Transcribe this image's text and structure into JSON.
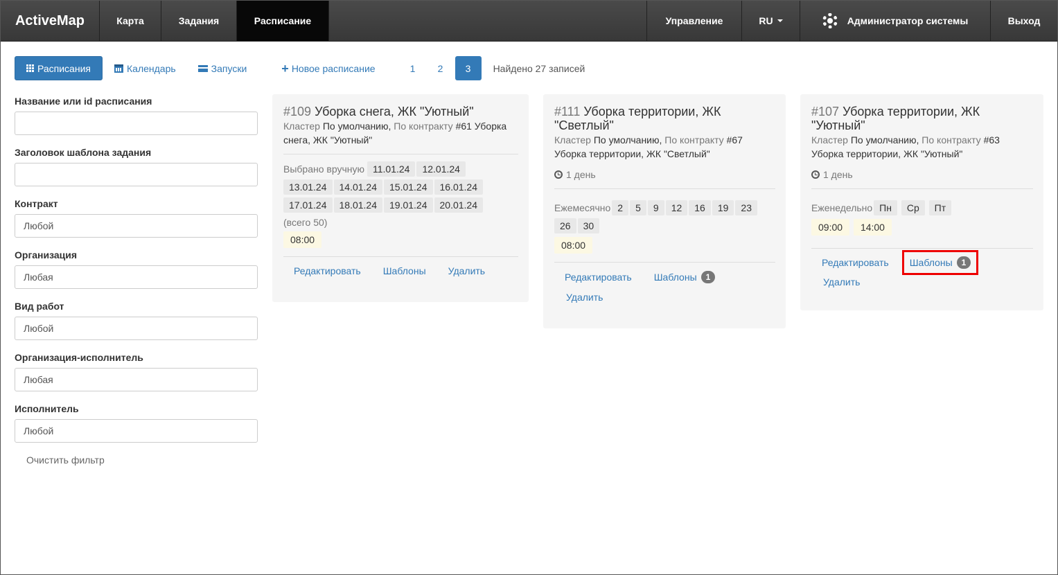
{
  "navbar": {
    "brand": "ActiveMap",
    "items": [
      {
        "label": "Карта"
      },
      {
        "label": "Задания"
      },
      {
        "label": "Расписание",
        "active": true
      }
    ],
    "right": {
      "manage": "Управление",
      "lang": "RU",
      "user": "Администратор системы",
      "logout": "Выход"
    }
  },
  "toolbar": {
    "schedules": "Расписания",
    "calendar": "Календарь",
    "launches": "Запуски",
    "new_schedule": "Новое расписание",
    "pages": [
      "1",
      "2",
      "3"
    ],
    "active_page": "3",
    "found": "Найдено 27 записей"
  },
  "filters": {
    "name_label": "Название или id расписания",
    "name_value": "",
    "template_label": "Заголовок шаблона задания",
    "template_value": "",
    "contract_label": "Контракт",
    "contract_value": "Любой",
    "org_label": "Организация",
    "org_value": "Любая",
    "work_label": "Вид работ",
    "work_value": "Любой",
    "exec_org_label": "Организация-исполнитель",
    "exec_org_value": "Любая",
    "executor_label": "Исполнитель",
    "executor_value": "Любой",
    "clear": "Очистить фильтр"
  },
  "cards": [
    {
      "num": "#109",
      "title": "Уборка снега, ЖК \"Уютный\"",
      "cluster_label": "Кластер",
      "cluster": "По умолчанию,",
      "contract_label": "По контракту",
      "contract": "#61 Уборка снега, ЖК \"Уютный\"",
      "mode": "Выбрано вручную",
      "dates": [
        "11.01.24",
        "12.01.24",
        "13.01.24",
        "14.01.24",
        "15.01.24",
        "16.01.24",
        "17.01.24",
        "18.01.24",
        "19.01.24",
        "20.01.24"
      ],
      "total": "(всего 50)",
      "times": [
        "08:00"
      ],
      "edit": "Редактировать",
      "templates": "Шаблоны",
      "delete": "Удалить"
    },
    {
      "num": "#111",
      "title": "Уборка территории, ЖК \"Светлый\"",
      "cluster_label": "Кластер",
      "cluster": "По умолчанию,",
      "contract_label": "По контракту",
      "contract": "#67 Уборка территории, ЖК \"Светлый\"",
      "duration": "1 день",
      "mode": "Ежемесячно",
      "days": [
        "2",
        "5",
        "9",
        "12",
        "16",
        "19",
        "23",
        "26",
        "30"
      ],
      "times": [
        "08:00"
      ],
      "edit": "Редактировать",
      "templates": "Шаблоны",
      "templates_count": "1",
      "delete": "Удалить"
    },
    {
      "num": "#107",
      "title": "Уборка территории, ЖК \"Уютный\"",
      "cluster_label": "Кластер",
      "cluster": "По умолчанию,",
      "contract_label": "По контракту",
      "contract": "#63 Уборка территории, ЖК \"Уютный\"",
      "duration": "1 день",
      "mode": "Еженедельно",
      "days": [
        "Пн",
        "Ср",
        "Пт"
      ],
      "times": [
        "09:00",
        "14:00"
      ],
      "edit": "Редактировать",
      "templates": "Шаблоны",
      "templates_count": "1",
      "delete": "Удалить",
      "highlight_color": "#e00000"
    }
  ]
}
